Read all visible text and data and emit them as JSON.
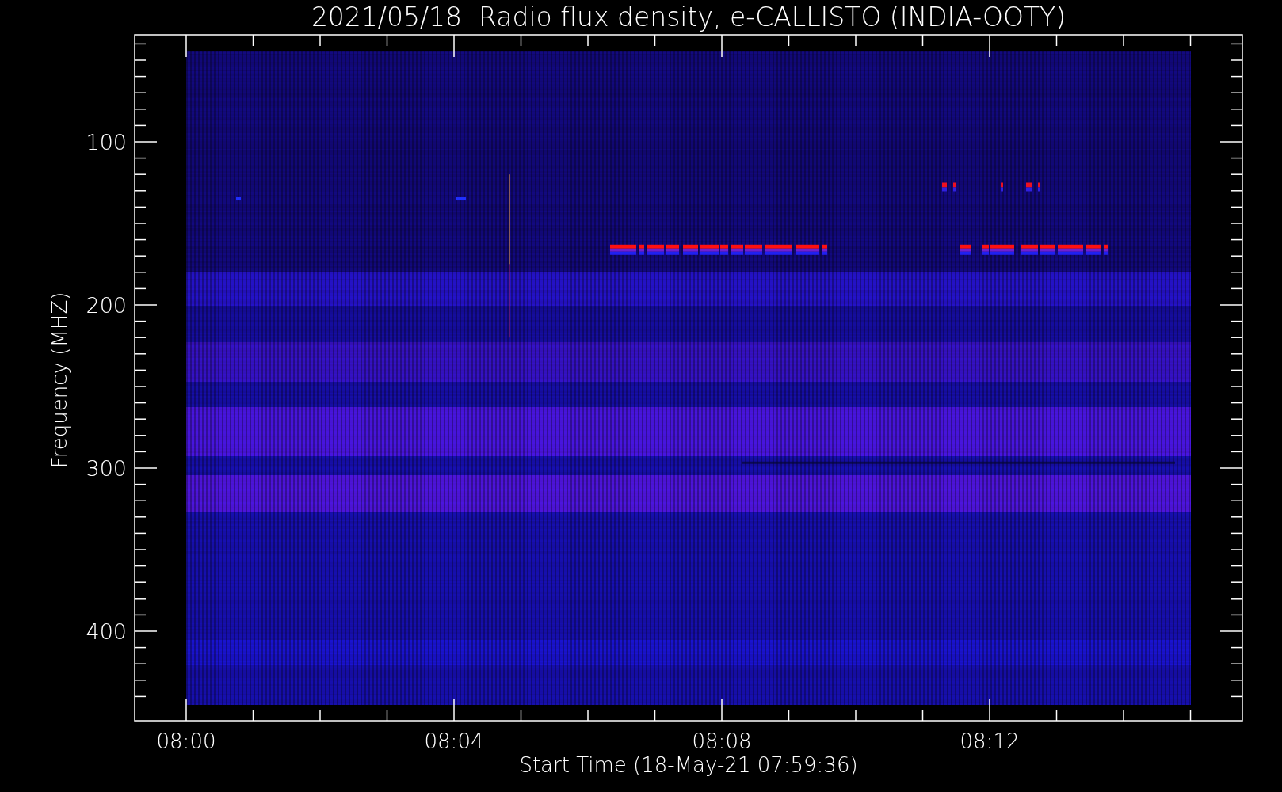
{
  "plot": {
    "title": "2021/05/18  Radio flux density, e-CALLISTO (INDIA-OOTY)",
    "ylabel": "Frequency (MHZ)",
    "xlabel": "Start Time (18-May-21 07:59:36)",
    "yticks": [
      "100",
      "200",
      "300",
      "400"
    ],
    "xticks": [
      "08:00",
      "08:04",
      "08:08",
      "08:12"
    ]
  }
}
